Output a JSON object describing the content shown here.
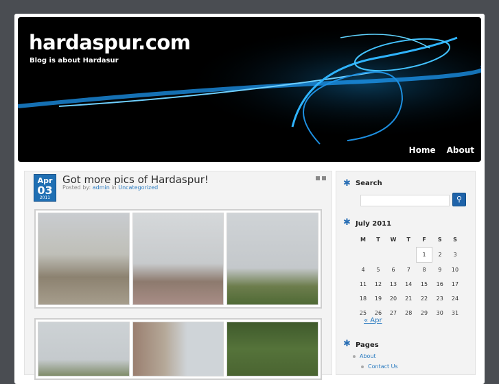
{
  "header": {
    "site_title": "hardaspur.com",
    "tagline": "Blog is about Hardasur",
    "nav": [
      "Home",
      "About"
    ]
  },
  "post": {
    "date_month": "Apr",
    "date_day": "03",
    "date_year": "2011",
    "title": "Got more pics of Hardaspur!",
    "posted_by_label": "Posted by:",
    "author": "admin",
    "in_label": "in",
    "category": "Uncategorized"
  },
  "sidebar": {
    "search_title": "Search",
    "calendar_title": "July 2011",
    "weekdays": [
      "M",
      "T",
      "W",
      "T",
      "F",
      "S",
      "S"
    ],
    "weeks": [
      [
        "",
        "",
        "",
        "",
        "1",
        "2",
        "3"
      ],
      [
        "4",
        "5",
        "6",
        "7",
        "8",
        "9",
        "10"
      ],
      [
        "11",
        "12",
        "13",
        "14",
        "15",
        "16",
        "17"
      ],
      [
        "18",
        "19",
        "20",
        "21",
        "22",
        "23",
        "24"
      ],
      [
        "25",
        "26",
        "27",
        "28",
        "29",
        "30",
        "31"
      ]
    ],
    "prev_link": "« Apr",
    "pages_title": "Pages",
    "pages": [
      "About",
      "Contact Us"
    ]
  },
  "colors": {
    "accent": "#1f6fb3",
    "link": "#2a7bc0",
    "background": "#4a4d52"
  }
}
